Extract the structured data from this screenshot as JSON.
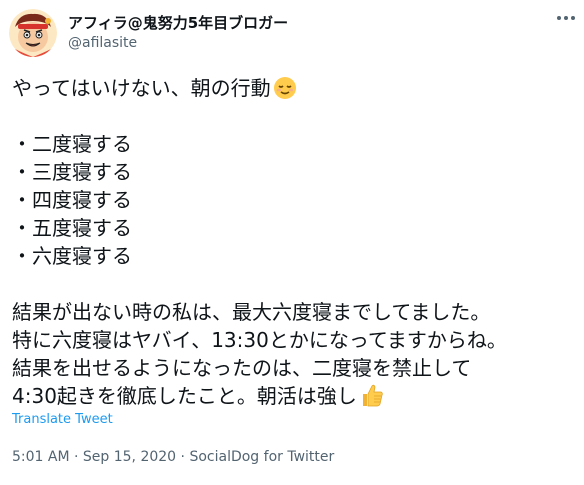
{
  "author": {
    "display_name": "アフィラ@鬼努力5年目ブロガー",
    "handle": "@afilasite"
  },
  "tweet": {
    "lines": [
      "やってはいけない、朝の行動",
      "",
      "・二度寝する",
      "・三度寝する",
      "・四度寝する",
      "・五度寝する",
      "・六度寝する",
      "",
      "結果が出ない時の私は、最大六度寝までしてました。",
      "特に六度寝はヤバイ、13:30とかになってますからね。",
      "結果を出せるようになったのは、二度寝を禁止して",
      "4:30起きを徹底したこと。朝活は強し"
    ],
    "emoji_first_line": "relieved-face-emoji",
    "emoji_last_line": "thumbs-up-emoji"
  },
  "translate_label": "Translate Tweet",
  "meta": {
    "time": "5:01 AM",
    "sep1": " · ",
    "date": "Sep 15, 2020",
    "sep2": " · ",
    "source": "SocialDog for Twitter"
  }
}
